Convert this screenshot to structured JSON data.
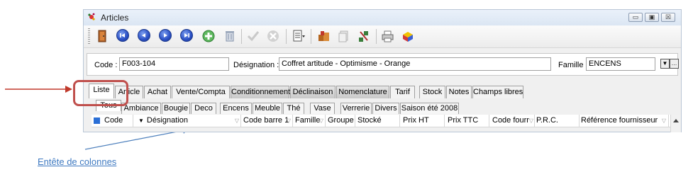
{
  "window": {
    "title": "Articles",
    "controls": {
      "minimize": "▭",
      "maximize": "▣",
      "close": "☒"
    }
  },
  "toolbar": {
    "buttons": [
      "door-exit-icon",
      "first-record-icon",
      "previous-record-icon",
      "next-record-icon",
      "last-record-icon",
      "add-record-icon",
      "delete-record-icon",
      "validate-icon",
      "cancel-icon",
      "report-icon",
      "stock-icon",
      "copy-icon",
      "tools-icon",
      "print-icon",
      "export-icon"
    ]
  },
  "fields": {
    "code_label": "Code :",
    "code_value": "F003-104",
    "designation_label": "Désignation :",
    "designation_value": "Coffret artitude - Optimisme - Orange",
    "famille_label": "Famille :",
    "famille_value": "ENCENS"
  },
  "tabs": [
    "Liste",
    "Article",
    "Achat",
    "Vente/Compta",
    "Conditionnement",
    "Déclinaison",
    "Nomenclature",
    "Tarif",
    "Stock",
    "Notes",
    "Champs libres"
  ],
  "subtabs": [
    "Tous",
    "Ambiance",
    "Bougie",
    "Deco",
    "Encens",
    "Meuble",
    "Thé",
    "Vase",
    "Verrerie",
    "Divers",
    "Saison été 2008"
  ],
  "grid": {
    "sort_marker": "▼",
    "filter_marker": "▽",
    "columns": [
      "Code",
      "Désignation",
      "Code barre 1",
      "Famille",
      "Groupe",
      "Stocké",
      "Prix HT",
      "Prix TTC",
      "Code fourr",
      "P.R.C.",
      "Référence fournisseur"
    ]
  },
  "annotation": {
    "label": "Entête de colonnes",
    "arrow_color": "#c0392b",
    "pointer_color": "#4f81bd"
  },
  "colors": {
    "callout": "#c0504d",
    "link_text": "#3e79c1",
    "toolbar_blue": "#2a4fc4"
  }
}
